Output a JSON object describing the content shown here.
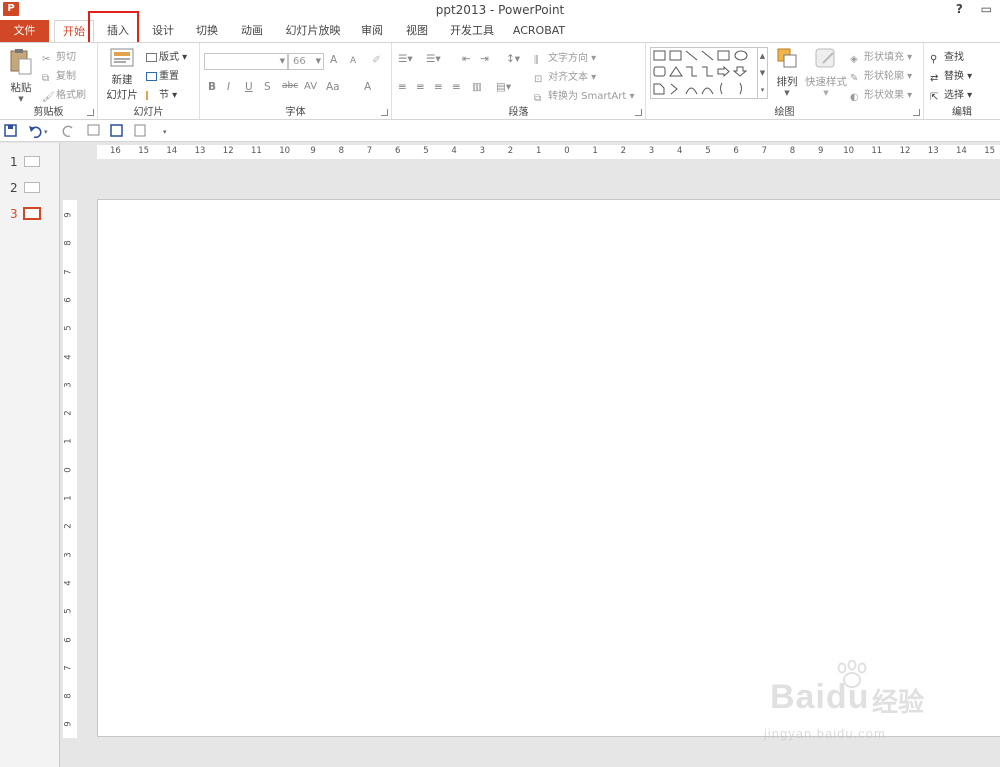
{
  "app": {
    "icon_letter": "P",
    "title": "ppt2013 - PowerPoint",
    "help_label": "?",
    "restore_label": "▭"
  },
  "tabs": [
    {
      "label": "文件"
    },
    {
      "label": "开始"
    },
    {
      "label": "插入"
    },
    {
      "label": "设计"
    },
    {
      "label": "切换"
    },
    {
      "label": "动画"
    },
    {
      "label": "幻灯片放映"
    },
    {
      "label": "审阅"
    },
    {
      "label": "视图"
    },
    {
      "label": "开发工具"
    },
    {
      "label": "ACROBAT"
    }
  ],
  "ribbon": {
    "clipboard": {
      "label": "剪贴板",
      "paste": "粘贴",
      "cut": "剪切",
      "copy": "复制",
      "format_painter": "格式刷"
    },
    "slides": {
      "label": "幻灯片",
      "new_slide_line1": "新建",
      "new_slide_line2": "幻灯片",
      "layout": "版式",
      "reset": "重置",
      "section": "节"
    },
    "font": {
      "label": "字体",
      "font_name": "",
      "font_size": "66",
      "bold": "B",
      "italic": "I",
      "underline": "U",
      "shadow": "S",
      "strike": "abc",
      "spacing": "AV",
      "case": "Aa",
      "color": "A",
      "grow": "A",
      "shrink": "A"
    },
    "paragraph": {
      "label": "段落",
      "text_direction": "文字方向",
      "align_text": "对齐文本",
      "smartart": "转换为 SmartArt"
    },
    "drawing": {
      "label": "绘图",
      "arrange": "排列",
      "quick_styles": "快速样式",
      "shape_fill": "形状填充",
      "shape_outline": "形状轮廓",
      "shape_effects": "形状效果"
    },
    "editing": {
      "label": "编辑",
      "find": "查找",
      "replace": "替换",
      "select": "选择"
    }
  },
  "slides_pane": [
    {
      "number": "1"
    },
    {
      "number": "2"
    },
    {
      "number": "3"
    }
  ],
  "ruler": {
    "horizontal": [
      "16",
      "15",
      "14",
      "13",
      "12",
      "11",
      "10",
      "9",
      "8",
      "7",
      "6",
      "5",
      "4",
      "3",
      "2",
      "1",
      "0",
      "1",
      "2",
      "3",
      "4",
      "5",
      "6",
      "7",
      "8",
      "9",
      "10",
      "11",
      "12",
      "13",
      "14",
      "15"
    ],
    "vertical": [
      "9",
      "8",
      "7",
      "6",
      "5",
      "4",
      "3",
      "2",
      "1",
      "0",
      "1",
      "2",
      "3",
      "4",
      "5",
      "6",
      "7",
      "8",
      "9"
    ]
  },
  "watermark": {
    "brand": "Bai",
    "brand2": "du",
    "product": "经验",
    "url": "jingyan.baidu.com"
  },
  "colors": {
    "accent": "#d24726",
    "highlight": "#e0201b"
  }
}
